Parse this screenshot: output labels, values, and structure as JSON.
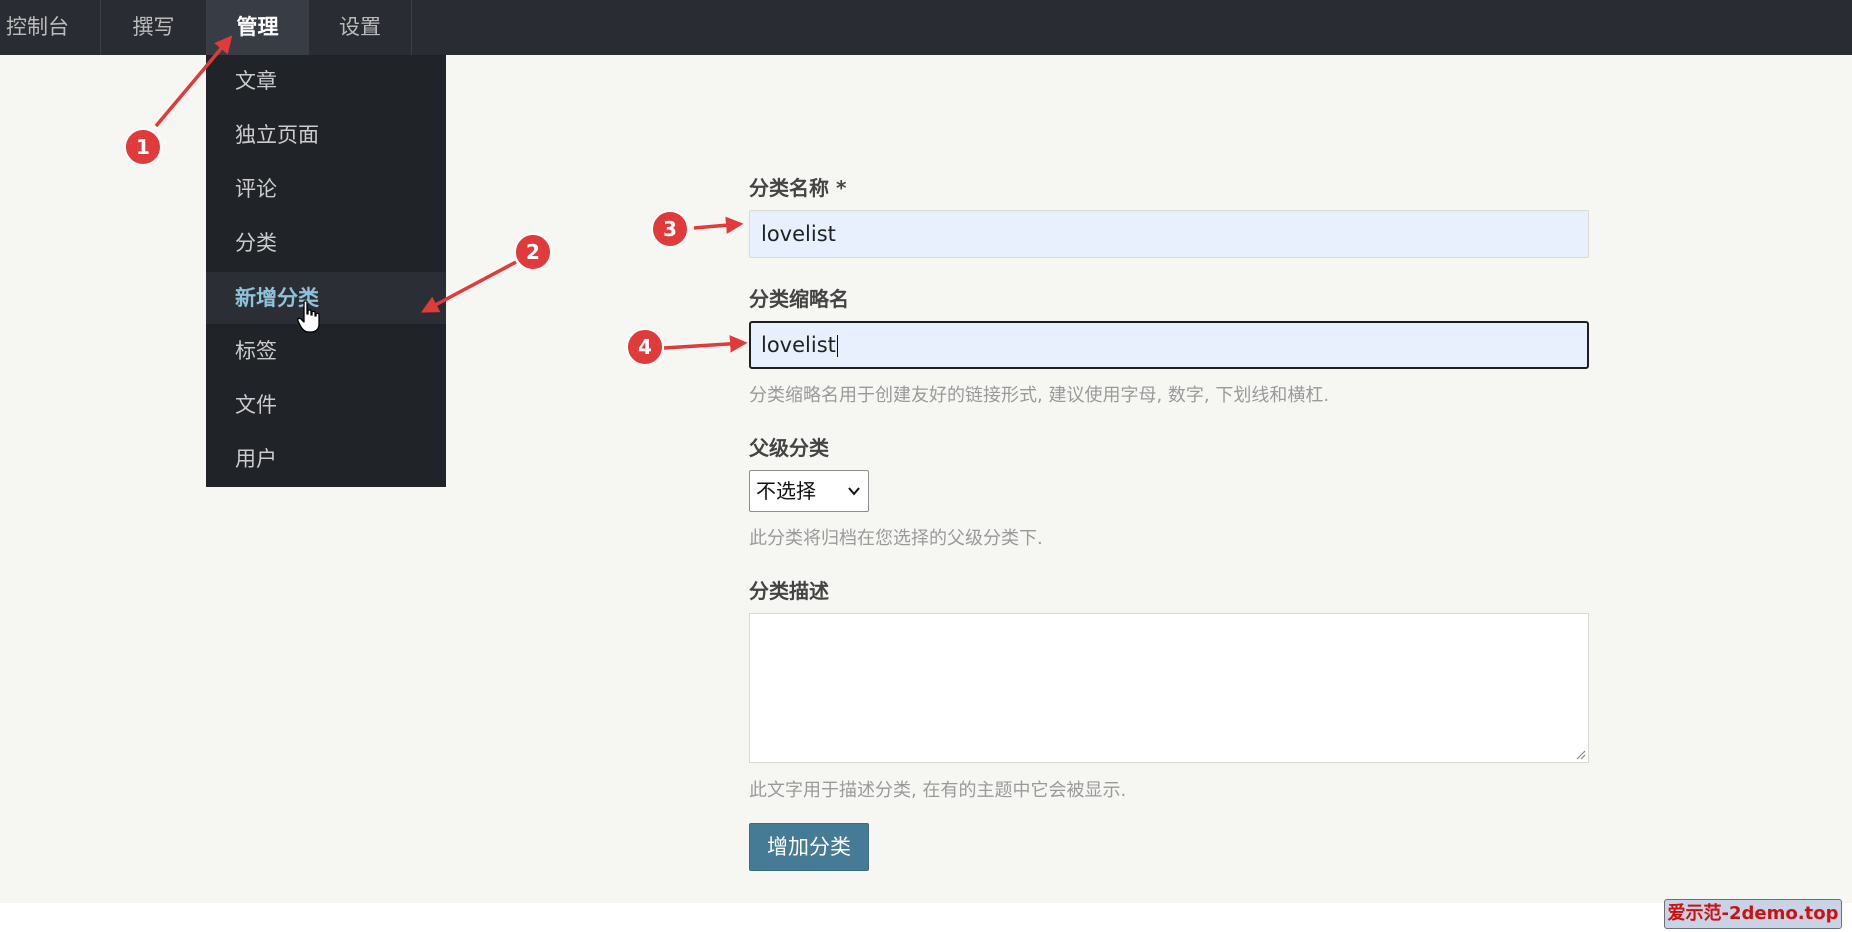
{
  "nav": {
    "items": [
      {
        "label": "控制台"
      },
      {
        "label": "撰写"
      },
      {
        "label": "管理",
        "active": true
      },
      {
        "label": "设置"
      }
    ]
  },
  "manage_menu": {
    "items": [
      {
        "label": "文章"
      },
      {
        "label": "独立页面"
      },
      {
        "label": "评论"
      },
      {
        "label": "分类"
      },
      {
        "label": "新增分类",
        "active": true
      },
      {
        "label": "标签"
      },
      {
        "label": "文件"
      },
      {
        "label": "用户"
      }
    ]
  },
  "form": {
    "name_label": "分类名称 *",
    "name_value": "lovelist",
    "slug_label": "分类缩略名",
    "slug_value": "lovelist",
    "slug_hint": "分类缩略名用于创建友好的链接形式, 建议使用字母, 数字, 下划线和横杠.",
    "parent_label": "父级分类",
    "parent_selected": "不选择",
    "parent_hint": "此分类将归档在您选择的父级分类下.",
    "desc_label": "分类描述",
    "desc_value": "",
    "desc_hint": "此文字用于描述分类, 在有的主题中它会被显示.",
    "submit_label": "增加分类"
  },
  "annotations": [
    "1",
    "2",
    "3",
    "4"
  ],
  "watermark": "爱示范-2demo.top",
  "colors": {
    "topbar": "#292d33",
    "dropdown": "#202328",
    "accent": "#467b96",
    "annotation": "#e03a3a",
    "active_menu_text": "#8fc1d9"
  }
}
